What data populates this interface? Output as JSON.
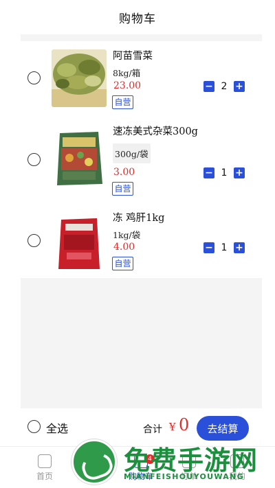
{
  "header": {
    "title": "购物车"
  },
  "cart": {
    "items": [
      {
        "name": "阿苗雪菜",
        "spec": "8kg/箱",
        "price": "23.00",
        "tag": "自营",
        "quantity": "2",
        "image_icon": "pickled-greens-image"
      },
      {
        "name": "速冻美式杂菜300g",
        "spec": "300g/袋",
        "price": "3.00",
        "tag": "自营",
        "quantity": "1",
        "image_icon": "frozen-mixed-vegetables-image"
      },
      {
        "name": "冻 鸡肝1kg",
        "spec": "1kg/袋",
        "price": "4.00",
        "tag": "自营",
        "quantity": "1",
        "image_icon": "frozen-chicken-liver-image"
      }
    ],
    "stepper": {
      "minus": "−",
      "plus": "+"
    }
  },
  "footer": {
    "select_all": "全选",
    "total_label": "合计",
    "currency": "¥",
    "total_value": "0",
    "checkout_label": "去结算"
  },
  "tabbar": {
    "tabs": [
      {
        "label": "首页",
        "icon": "home-icon"
      },
      {
        "label": "购物车",
        "icon": "cart-icon",
        "badge": "4"
      },
      {
        "label": "订单",
        "icon": "order-icon"
      },
      {
        "label": "我的",
        "icon": "user-icon"
      }
    ]
  },
  "watermark": {
    "title": "免费手游网",
    "subtitle": "MIANFEISHOUYOUWANG"
  },
  "colors": {
    "accent": "#2a4fd8",
    "price": "#e02b2b",
    "watermark": "#1b8f3e"
  }
}
